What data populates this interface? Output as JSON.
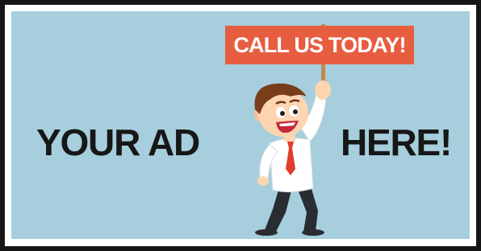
{
  "ad": {
    "left_text": "YOUR AD",
    "right_text": "HERE!",
    "cta": "CALL US TODAY!"
  },
  "colors": {
    "panel_bg": "#a6cedd",
    "frame": "#161616",
    "sign": "#e75d40",
    "headline": "#171717"
  },
  "icons": {
    "character": "cartoon-businessman-holding-sign"
  }
}
